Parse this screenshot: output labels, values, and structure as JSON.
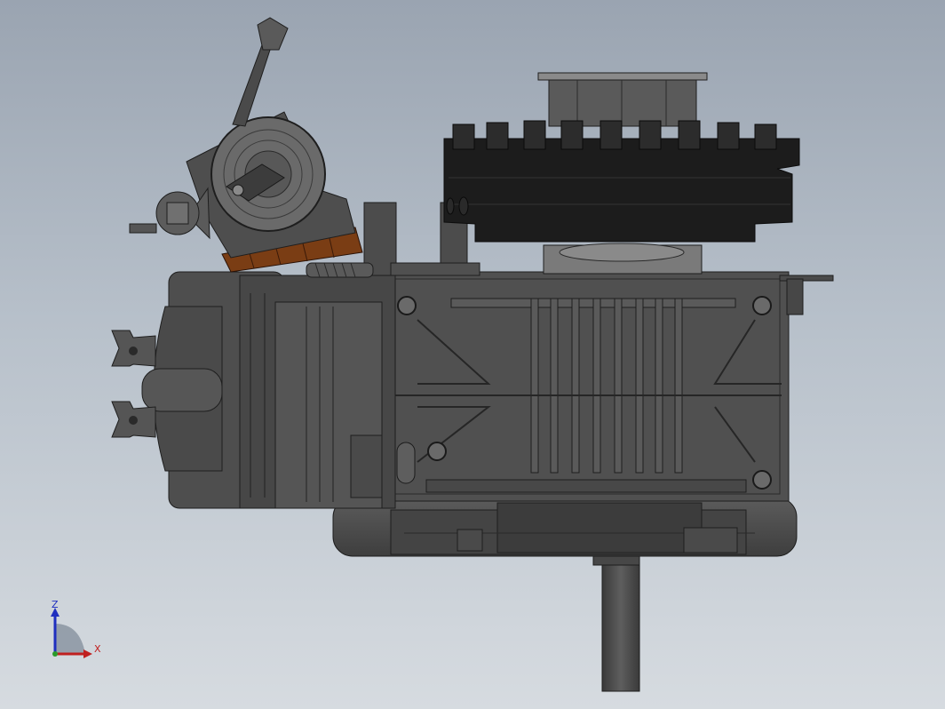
{
  "viewport": {
    "background_top": "#9aa4b1",
    "background_bottom": "#d6dbe0"
  },
  "model": {
    "body_color": "#4b4b4b",
    "edge_color": "#1e1e1e",
    "fan_color": "#1c1c1c",
    "coil_color": "#7a3d14"
  },
  "triad": {
    "z_label": "Z",
    "x_label": "X",
    "z_color": "#1f2fbf",
    "x_color": "#c02020"
  }
}
